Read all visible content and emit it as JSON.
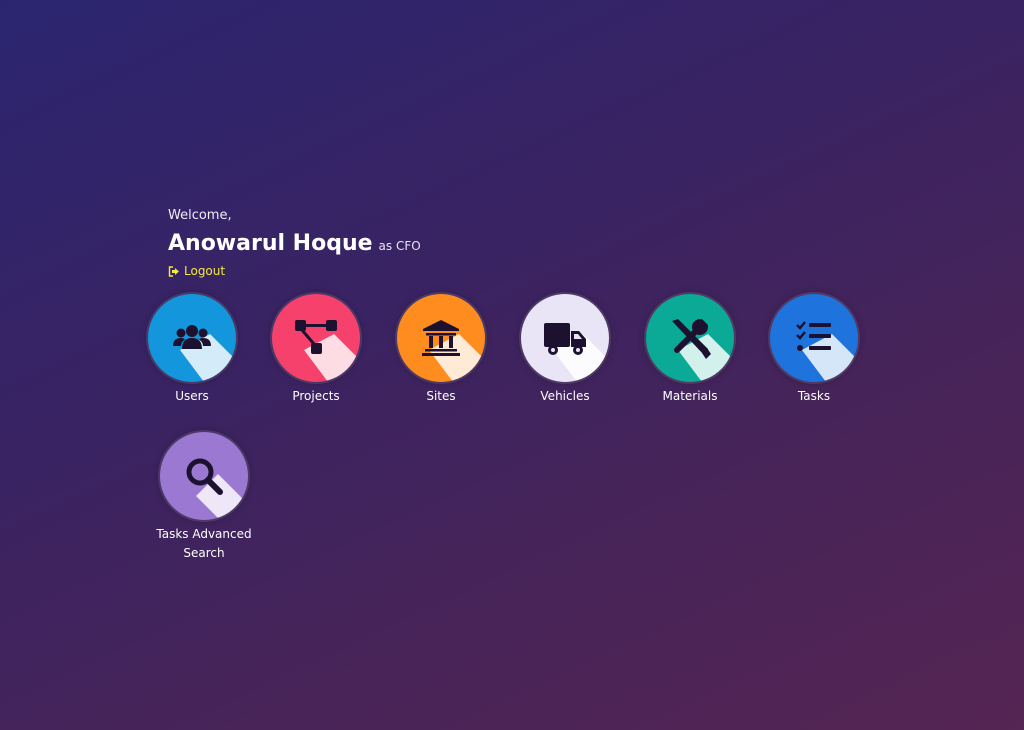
{
  "header": {
    "welcome": "Welcome,",
    "name": "Anowarul Hoque",
    "role": "as CFO",
    "logout": "Logout"
  },
  "tiles": [
    {
      "label": "Users",
      "icon": "users-icon",
      "color": "#1496dc"
    },
    {
      "label": "Projects",
      "icon": "sitemap-icon",
      "color": "#f5416b"
    },
    {
      "label": "Sites",
      "icon": "institution-icon",
      "color": "#ff8c1e"
    },
    {
      "label": "Vehicles",
      "icon": "truck-icon",
      "color": "#e9e4f6"
    },
    {
      "label": "Materials",
      "icon": "wrench-screwdriver-icon",
      "color": "#0aaa96"
    },
    {
      "label": "Tasks",
      "icon": "task-list-icon",
      "color": "#1e73dc"
    },
    {
      "label": "Tasks Advanced Search",
      "icon": "search-icon",
      "color": "#9b78d2"
    }
  ],
  "colors": {
    "logout": "#f5e83b",
    "icon_dark": "#1c1230"
  }
}
